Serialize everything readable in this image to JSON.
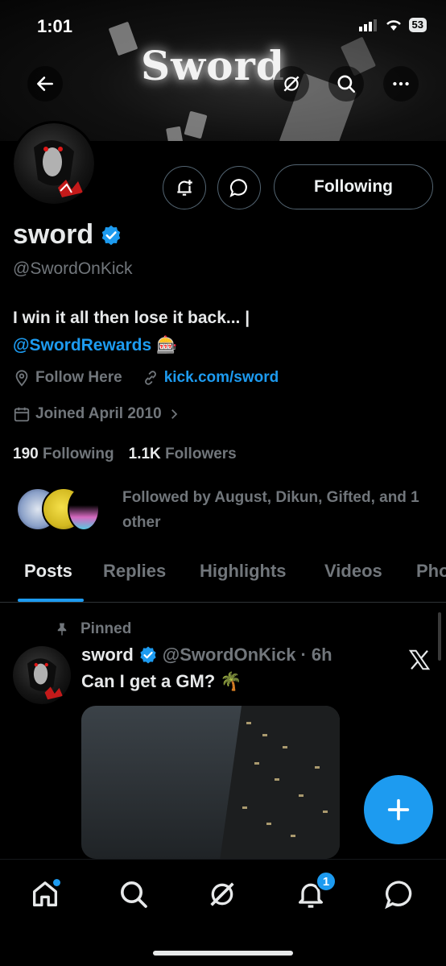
{
  "status_bar": {
    "time": "1:01",
    "battery": "53"
  },
  "banner": {
    "title_text": "Sword"
  },
  "profile": {
    "display_name": "sword",
    "handle": "@SwordOnKick",
    "follow_button_label": "Following",
    "bio_line1": "I win it all then lose it back... |",
    "bio_mention": "@SwordRewards",
    "bio_emoji": "🎰",
    "location": "Follow Here",
    "website": "kick.com/sword",
    "joined": "Joined April 2010",
    "following_count": "190",
    "following_label": "Following",
    "followers_count": "1.1K",
    "followers_label": "Followers",
    "followed_by_text": "Followed by August, Dikun, Gifted, and 1 other"
  },
  "tabs": [
    {
      "label": "Posts",
      "active": true
    },
    {
      "label": "Replies",
      "active": false
    },
    {
      "label": "Highlights",
      "active": false
    },
    {
      "label": "Videos",
      "active": false
    },
    {
      "label": "Pho",
      "active": false
    }
  ],
  "pinned_post": {
    "pinned_label": "Pinned",
    "author_name": "sword",
    "author_handle": "@SwordOnKick",
    "separator": "·",
    "time": "6h",
    "text": "Can I get a GM? 🌴"
  },
  "bottom_nav": {
    "notifications_badge": "1"
  },
  "colors": {
    "accent": "#1d9bf0",
    "background": "#000000",
    "muted": "#71767b"
  }
}
